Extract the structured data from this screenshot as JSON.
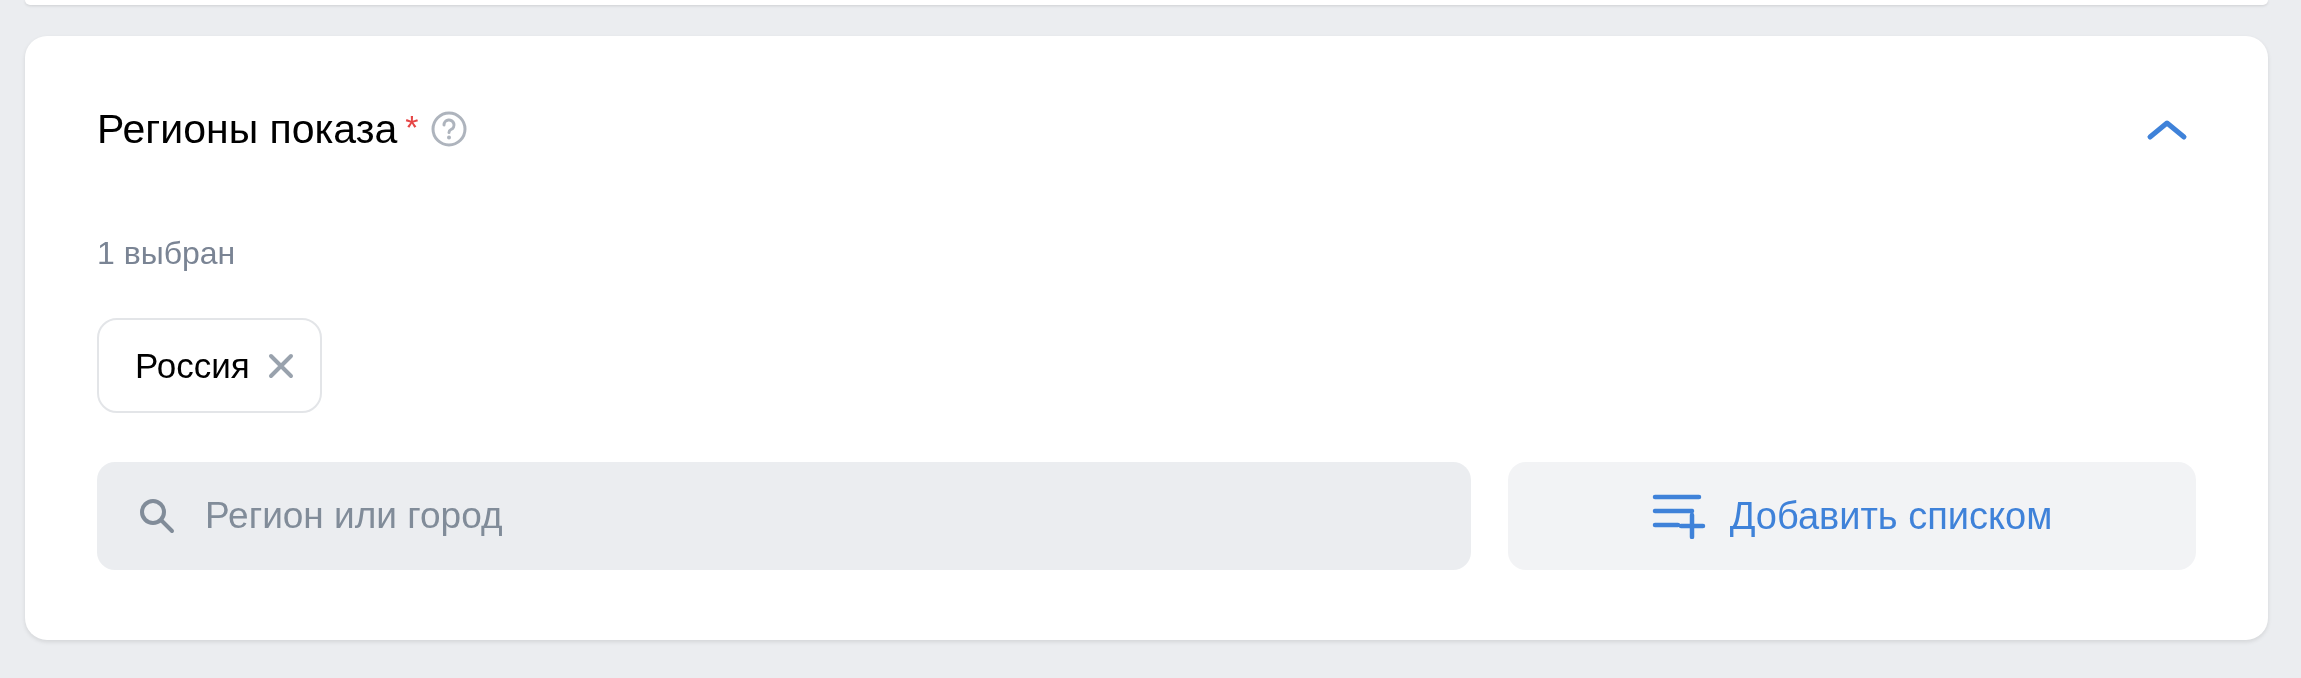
{
  "section": {
    "title": "Регионы показа",
    "required_mark": "*",
    "expanded": true
  },
  "selected_count": "1 выбран",
  "chips": [
    {
      "label": "Россия"
    }
  ],
  "search": {
    "placeholder": "Регион или город"
  },
  "add_list_button": {
    "label": "Добавить списком"
  }
}
